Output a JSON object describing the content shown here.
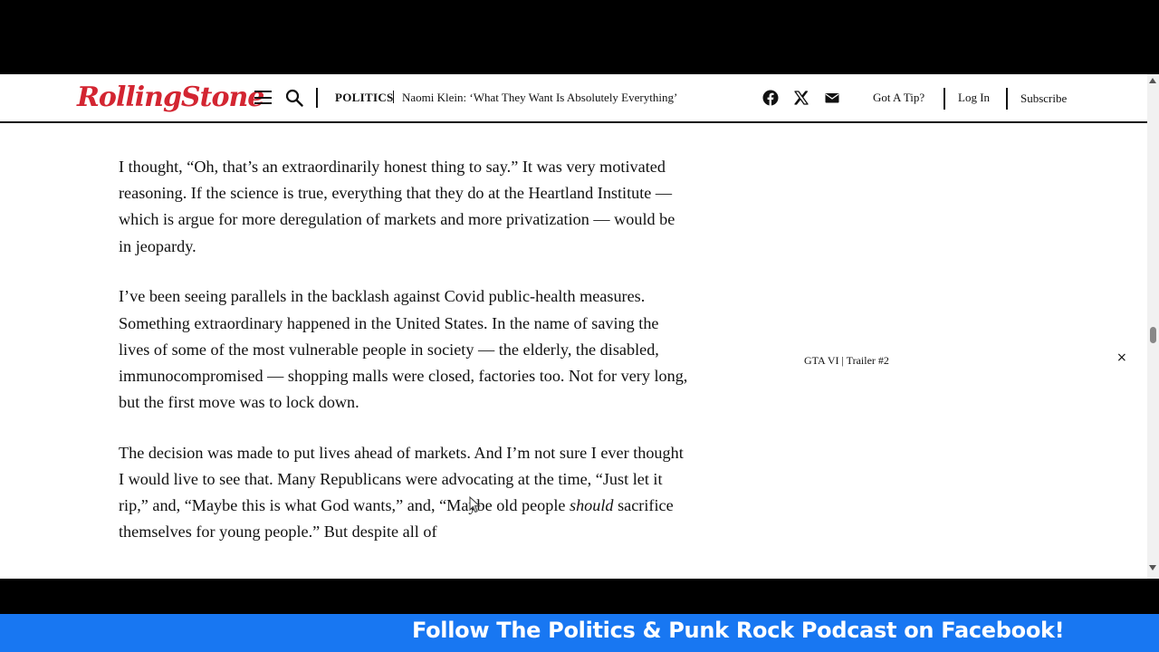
{
  "header": {
    "logo_text": "RollingStone",
    "section": "POLITICS",
    "headline": "Naomi Klein: ‘What They Want Is Absolutely Everything’",
    "tip_link": "Got A Tip?",
    "login_link": "Log In",
    "subscribe_link": "Subscribe",
    "social_icons": [
      "facebook-icon",
      "x-icon",
      "email-icon"
    ]
  },
  "article": {
    "paragraphs": [
      "I thought, “Oh, that’s an extraordinarily honest thing to say.” It was very motivated reasoning. If the science is true, everything that they do at the Heartland Institute — which is argue for more deregulation of markets and more privatization — would be in jeopardy.",
      "I’ve been seeing parallels in the backlash against Covid public-health measures. Something extraordinary happened in the United States. In the name of saving the lives of some of the most vulnerable people in society — the elderly, the disabled, immunocompromised — shopping malls were closed, factories too. Not for very long, but the first move was to lock down."
    ],
    "p3_before": "The decision was made to put lives ahead of markets. And I’m not sure I ever thought I would live to see that. Many Republicans were advocating at the time, “Just let it rip,” and, “Maybe this is what God wants,” and, “Maybe old people ",
    "p3_em": "should",
    "p3_after": " sacrifice themselves for young people.” But despite all of"
  },
  "video": {
    "label": "GTA VI | Trailer #2",
    "close_symbol": "×"
  },
  "banner": {
    "text": "Follow The Politics & Punk Rock Podcast on Facebook!",
    "color": "#1877f2"
  },
  "colors": {
    "logo_red": "#d32531",
    "text": "#111111"
  }
}
